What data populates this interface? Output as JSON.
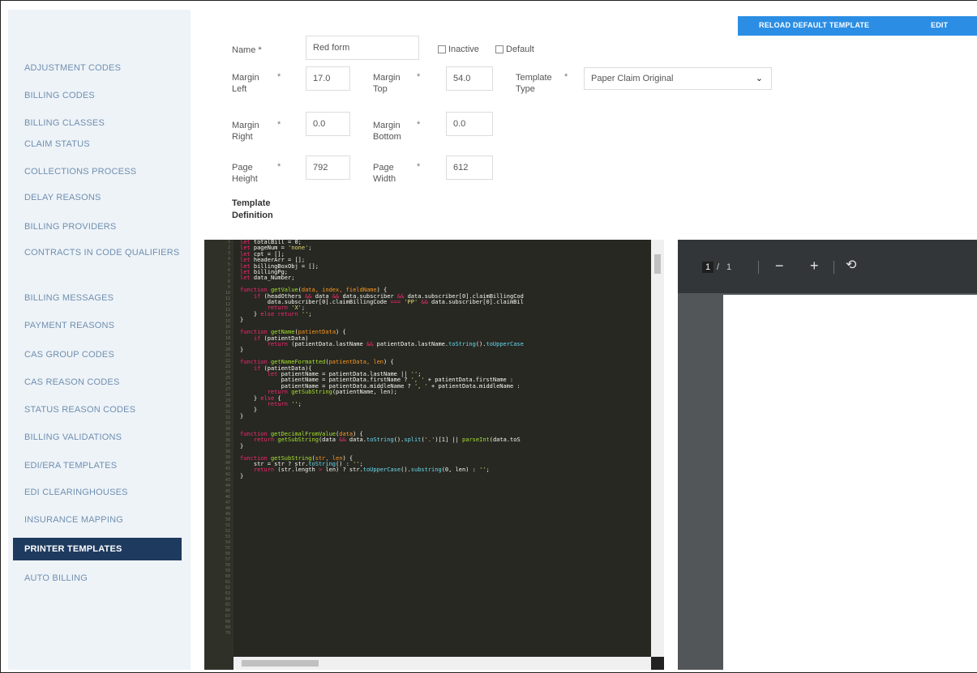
{
  "toolbar": {
    "reload_label": "RELOAD DEFAULT TEMPLATE",
    "edit_label": "EDIT"
  },
  "sidebar": {
    "items": [
      {
        "label": "ADJUSTMENT CODES"
      },
      {
        "label": "BILLING CODES"
      },
      {
        "label": "BILLING CLASSES"
      },
      {
        "label": "CLAIM STATUS"
      },
      {
        "label": "COLLECTIONS PROCESS"
      },
      {
        "label": "DELAY REASONS"
      },
      {
        "label": "BILLING PROVIDERS"
      },
      {
        "label": "CONTRACTS IN CODE QUALIFIERS"
      },
      {
        "label": "BILLING MESSAGES"
      },
      {
        "label": "PAYMENT REASONS"
      },
      {
        "label": "CAS GROUP CODES"
      },
      {
        "label": "CAS REASON CODES"
      },
      {
        "label": "STATUS REASON CODES"
      },
      {
        "label": "BILLING VALIDATIONS"
      },
      {
        "label": "EDI/ERA TEMPLATES"
      },
      {
        "label": "EDI CLEARINGHOUSES"
      },
      {
        "label": "INSURANCE MAPPING"
      },
      {
        "label": "PRINTER TEMPLATES"
      },
      {
        "label": "AUTO BILLING"
      }
    ],
    "active_index": 17
  },
  "form": {
    "name": {
      "label": "Name",
      "required": "*",
      "value": "Red form"
    },
    "inactive_label": "Inactive",
    "default_label": "Default",
    "margin_left": {
      "label": "Margin Left",
      "required": "*",
      "value": "17.0"
    },
    "margin_top": {
      "label": "Margin Top",
      "required": "*",
      "value": "54.0"
    },
    "template_type": {
      "label": "Template Type",
      "required": "*",
      "value": "Paper Claim Original"
    },
    "margin_right": {
      "label": "Margin Right",
      "required": "*",
      "value": "0.0"
    },
    "margin_bottom": {
      "label": "Margin Bottom",
      "required": "*",
      "value": "0.0"
    },
    "page_height": {
      "label": "Page Height",
      "required": "*",
      "value": "792"
    },
    "page_width": {
      "label": "Page Width",
      "required": "*",
      "value": "612"
    },
    "template_definition_label": "Template Definition"
  },
  "pdf_viewer": {
    "current_page": "1",
    "separator": "/",
    "total_pages": "1",
    "zoom_out_icon": "minus-icon",
    "zoom_in_icon": "plus-icon",
    "rotate_icon": "rotate-icon"
  },
  "colors": {
    "accent": "#2b8ee4",
    "sidebar_active": "#1e3a5f",
    "sidebar_bg": "#eef3f8",
    "editor_bg": "#272822",
    "pdf_toolbar": "#323639"
  }
}
